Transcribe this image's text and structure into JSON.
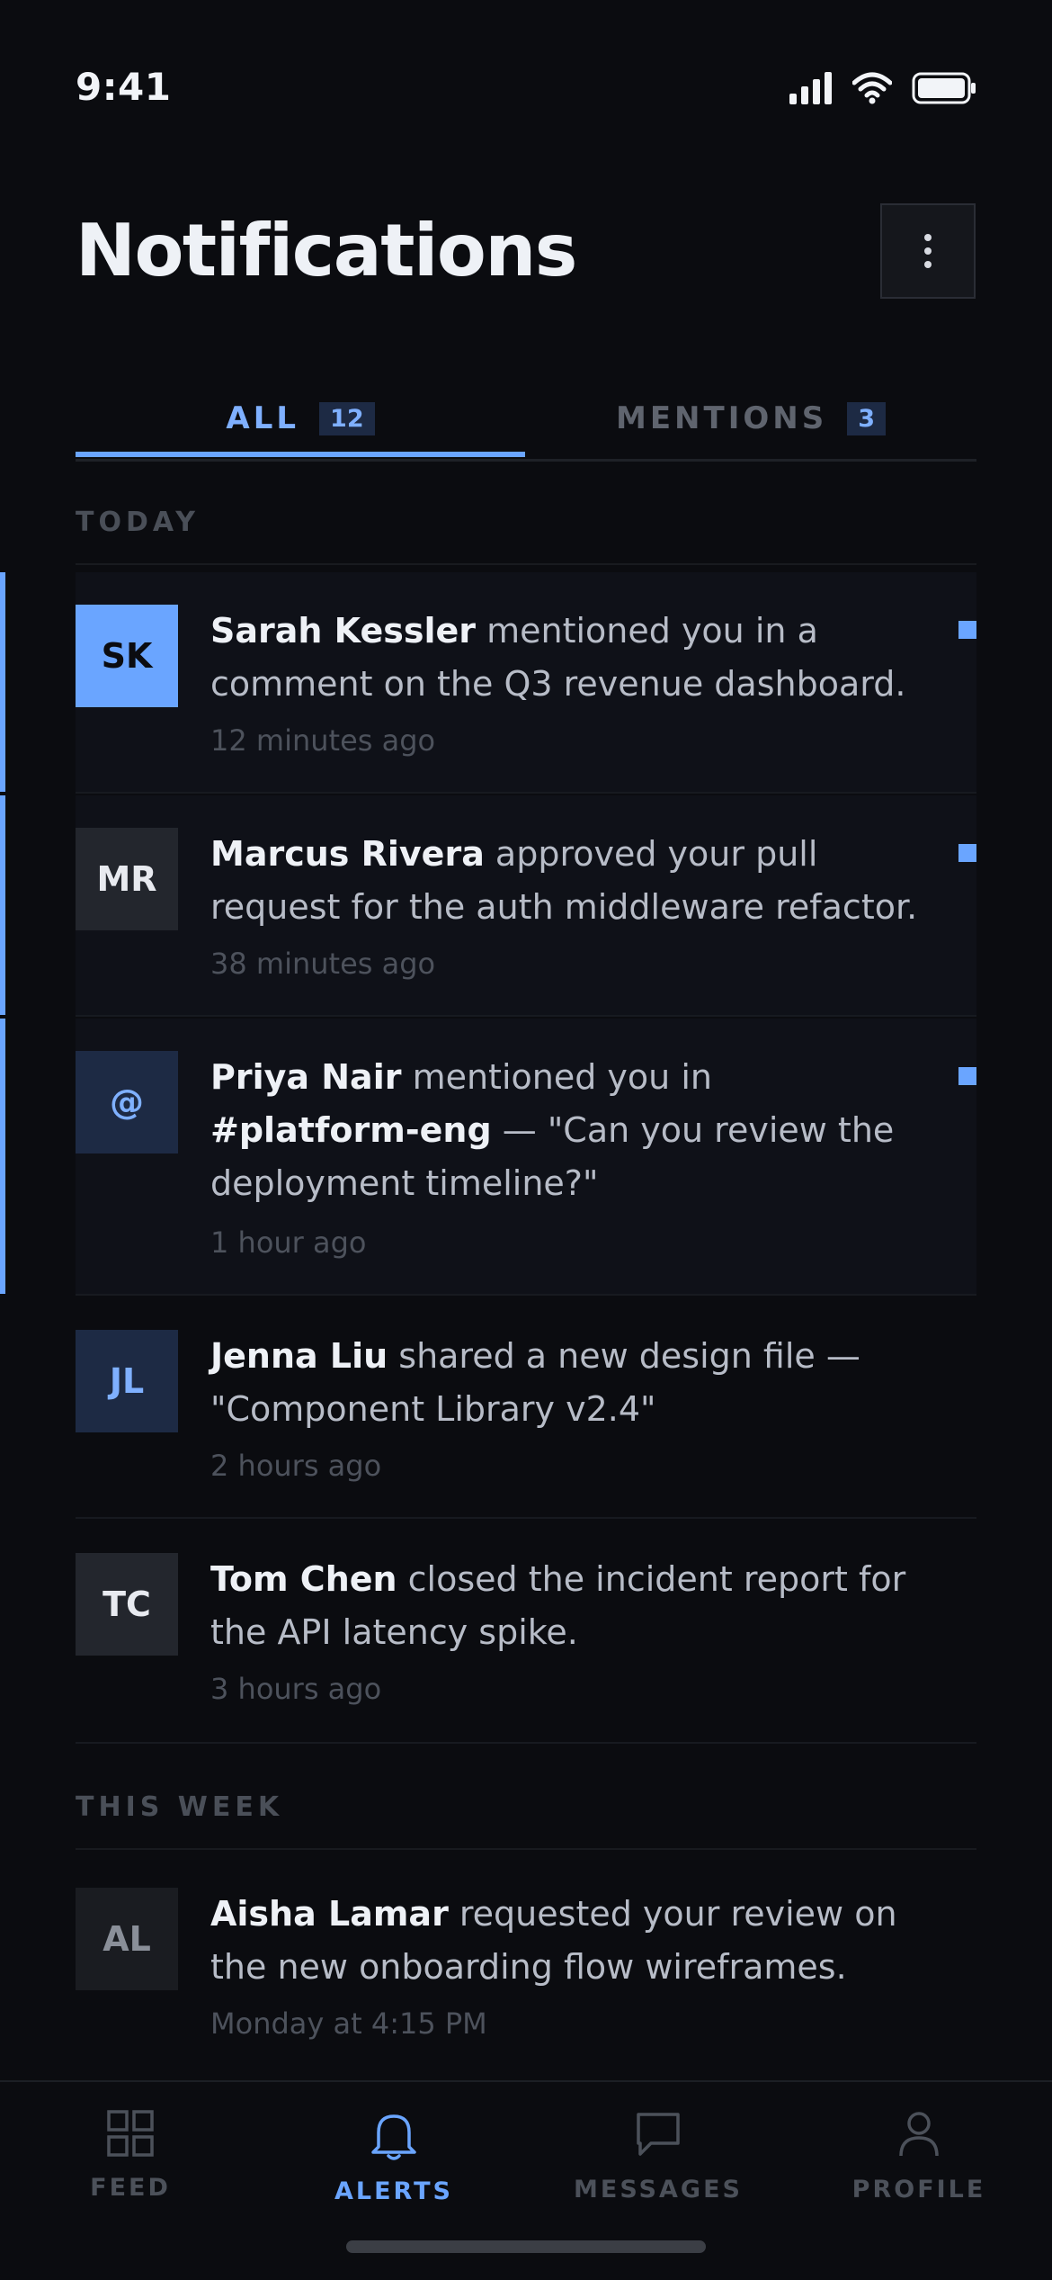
{
  "status_bar": {
    "time": "9:41"
  },
  "header": {
    "title": "Notifications"
  },
  "tabs": [
    {
      "label": "ALL",
      "count": "12",
      "active": true
    },
    {
      "label": "MENTIONS",
      "count": "3",
      "active": false
    }
  ],
  "sections": {
    "today": "TODAY",
    "this_week": "THIS WEEK"
  },
  "notifications": [
    {
      "initials": "SK",
      "name": "Sarah Kessler",
      "text": " mentioned you in a comment on the Q3 revenue dashboard.",
      "time": "12 minutes ago",
      "unread": true,
      "avatar_bg": "#6aa5ff",
      "avatar_fg": "#0b0c10"
    },
    {
      "initials": "MR",
      "name": "Marcus Rivera",
      "text": " approved your pull request for the auth middleware refactor.",
      "time": "38 minutes ago",
      "unread": true,
      "avatar_bg": "#23262d",
      "avatar_fg": "#e8eaf0"
    },
    {
      "initials": "@",
      "name": "Priya Nair",
      "text_before": " mentioned you in ",
      "channel": "#platform-eng",
      "text_after": " — \"Can you review the deployment timeline?\"",
      "time": "1 hour ago",
      "unread": true,
      "avatar_bg": "#1d2a44",
      "avatar_fg": "#7fb0ff"
    },
    {
      "initials": "JL",
      "name": "Jenna Liu",
      "text": " shared a new design file — \"Component Library v2.4\"",
      "time": "2 hours ago",
      "unread": false,
      "avatar_bg": "#1d2a44",
      "avatar_fg": "#7fb0ff"
    },
    {
      "initials": "TC",
      "name": "Tom Chen",
      "text": " closed the incident report for the API latency spike.",
      "time": "3 hours ago",
      "unread": false,
      "avatar_bg": "#23262d",
      "avatar_fg": "#e8eaf0"
    },
    {
      "initials": "AL",
      "name": "Aisha Lamar",
      "text": " requested your review on the new onboarding flow wireframes.",
      "time": "Monday at 4:15 PM",
      "unread": false,
      "avatar_bg": "#1a1c21",
      "avatar_fg": "#8a8f99"
    }
  ],
  "bottom_nav": [
    {
      "label": "FEED",
      "icon": "grid-icon",
      "active": false
    },
    {
      "label": "ALERTS",
      "icon": "bell-icon",
      "active": true
    },
    {
      "label": "MESSAGES",
      "icon": "chat-bubble-icon",
      "active": false
    },
    {
      "label": "PROFILE",
      "icon": "person-icon",
      "active": false
    }
  ],
  "colors": {
    "accent": "#6aa5ff",
    "background": "#0b0c10",
    "unread_row": "#0f1118"
  }
}
